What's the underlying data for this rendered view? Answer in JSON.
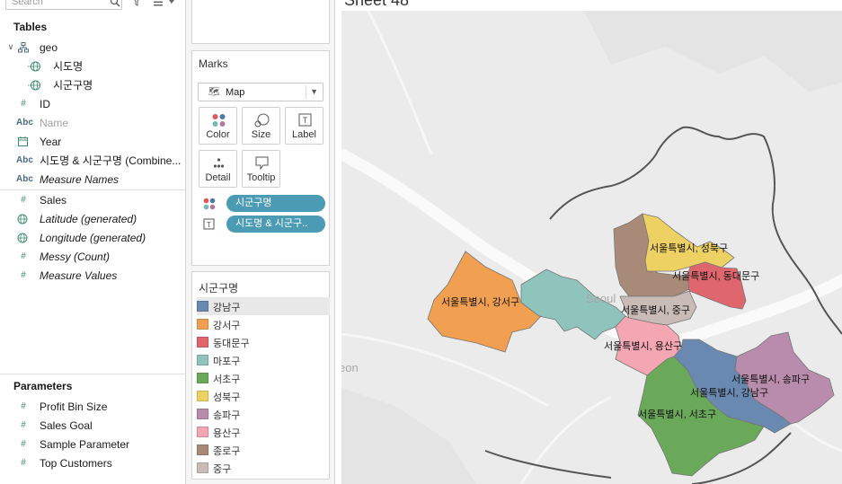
{
  "data_pane": {
    "search_placeholder": "Search",
    "tables_header": "Tables",
    "fields": [
      {
        "label": "geo",
        "icon": "table-icon",
        "italic": false
      },
      {
        "label": "시도명",
        "icon": "globe-icon",
        "italic": false
      },
      {
        "label": "시군구명",
        "icon": "globe-icon",
        "italic": false
      },
      {
        "label": "ID",
        "icon": "hash-icon",
        "italic": false
      },
      {
        "label": "Name",
        "icon": "abc-icon",
        "italic": false
      },
      {
        "label": "Year",
        "icon": "calendar-icon",
        "italic": false
      },
      {
        "label": "시도명 & 시군구명 (Combine...",
        "icon": "abc-icon",
        "italic": false
      },
      {
        "label": "Measure Names",
        "icon": "abc-icon",
        "italic": true
      },
      {
        "label": "Sales",
        "icon": "hash-icon",
        "italic": false
      },
      {
        "label": "Latitude (generated)",
        "icon": "globe-icon",
        "italic": true
      },
      {
        "label": "Longitude (generated)",
        "icon": "globe-icon",
        "italic": true
      },
      {
        "label": "Messy (Count)",
        "icon": "hash-icon",
        "italic": true
      },
      {
        "label": "Measure Values",
        "icon": "hash-icon",
        "italic": true
      }
    ],
    "parameters_header": "Parameters",
    "parameters": [
      "Profit Bin Size",
      "Sales Goal",
      "Sample Parameter",
      "Top Customers"
    ]
  },
  "marks": {
    "title": "Marks",
    "mark_type": "Map",
    "buttons": {
      "color": "Color",
      "size": "Size",
      "label": "Label",
      "detail": "Detail",
      "tooltip": "Tooltip"
    },
    "pills": [
      "시군구명",
      "시도명 & 시군구.."
    ]
  },
  "legend": {
    "title": "시군구명",
    "items": [
      {
        "label": "강남구",
        "color": "#6a89b0"
      },
      {
        "label": "강서구",
        "color": "#f0a050"
      },
      {
        "label": "동대문구",
        "color": "#e0666d"
      },
      {
        "label": "마포구",
        "color": "#8fc4bd"
      },
      {
        "label": "서초구",
        "color": "#6aa95a"
      },
      {
        "label": "성북구",
        "color": "#eed163"
      },
      {
        "label": "송파구",
        "color": "#b98bac"
      },
      {
        "label": "용산구",
        "color": "#f4a7b2"
      },
      {
        "label": "종로구",
        "color": "#a88a79"
      },
      {
        "label": "중구",
        "color": "#c9bcb7"
      }
    ]
  },
  "map": {
    "base_labels": {
      "city": "Seoul",
      "left_edge": "eon"
    },
    "region_labels": {
      "seongbuk": "서울특별시, 성북구",
      "dongdaemun": "서울특별시, 동대문구",
      "gangseo": "서울특별시, 강서구",
      "junggu": "서울특별시, 중구",
      "yongsan": "서울특별시, 용산구",
      "songpa": "서울특별시, 송파구",
      "gangnam": "서울특별시, 강남구",
      "seocho": "서울특별시, 서초구"
    }
  }
}
